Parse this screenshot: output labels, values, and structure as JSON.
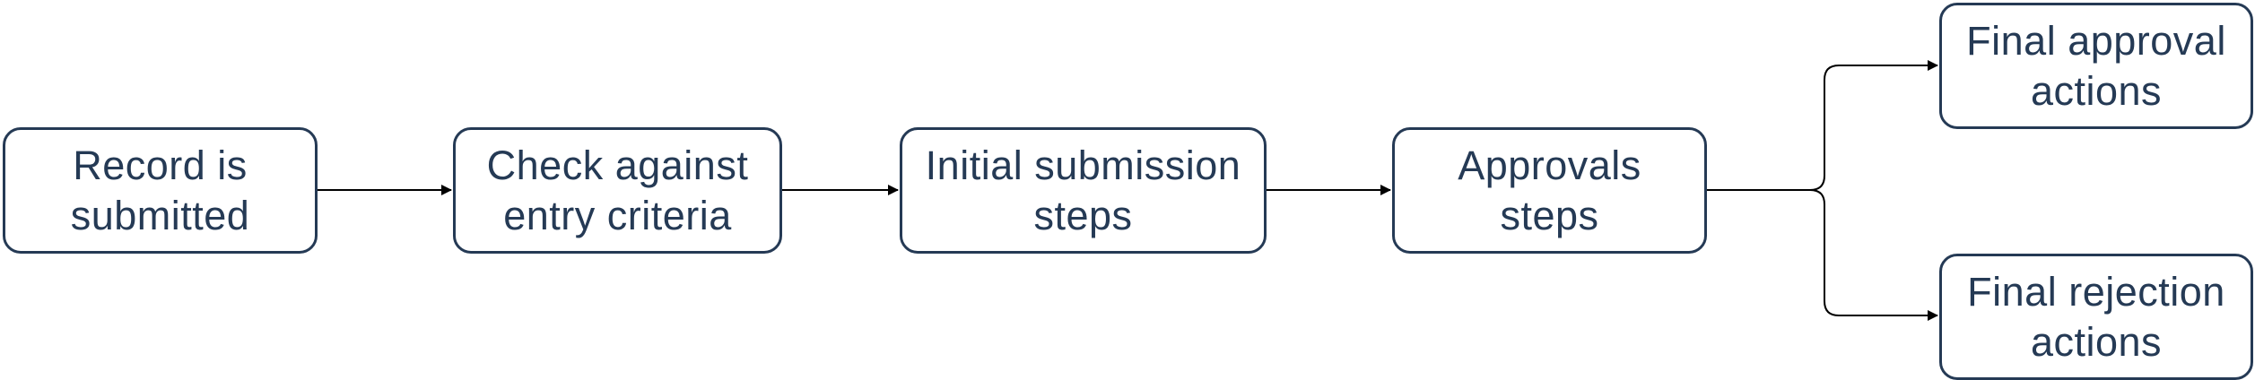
{
  "diagram": {
    "nodes": {
      "record_submitted": "Record is submitted",
      "check_entry_criteria": "Check against entry criteria",
      "initial_submission_steps": "Initial submission steps",
      "approvals_steps": "Approvals steps",
      "final_approval_actions": "Final approval actions",
      "final_rejection_actions": "Final rejection actions"
    },
    "edges": [
      {
        "from": "record_submitted",
        "to": "check_entry_criteria"
      },
      {
        "from": "check_entry_criteria",
        "to": "initial_submission_steps"
      },
      {
        "from": "initial_submission_steps",
        "to": "approvals_steps"
      },
      {
        "from": "approvals_steps",
        "to": "final_approval_actions"
      },
      {
        "from": "approvals_steps",
        "to": "final_rejection_actions"
      }
    ],
    "colors": {
      "node_border": "#253a55",
      "node_text": "#253a55",
      "arrow": "#000000",
      "background": "#ffffff"
    }
  }
}
